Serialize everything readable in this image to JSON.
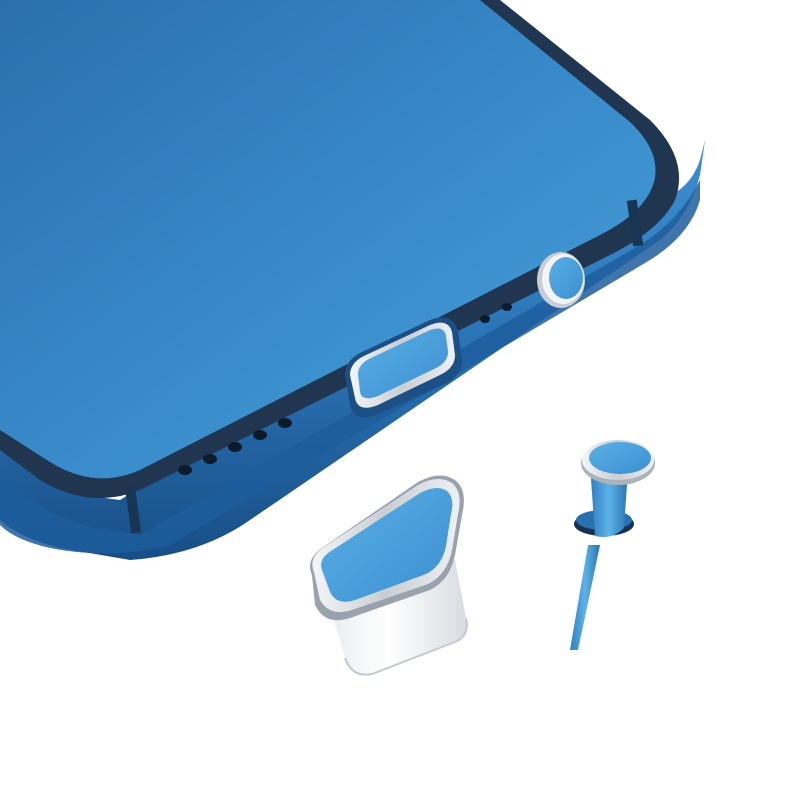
{
  "scene": {
    "subject": "phone-with-port-dust-plugs",
    "colors": {
      "background": "#ffffff",
      "phone_body": "#2f7fc0",
      "phone_screen_light": "#3f9ad2",
      "phone_screen_dark": "#2b6fae",
      "bezel": "#1f3550",
      "frame_dark": "#163a63",
      "plug_blue": "#4a9fdc",
      "metal_silver": "#d9dde2",
      "hole_dark": "#0c1a2b"
    },
    "items": [
      {
        "name": "phone"
      },
      {
        "name": "usb-c-dust-plug"
      },
      {
        "name": "headphone-jack-dust-plug"
      }
    ]
  }
}
